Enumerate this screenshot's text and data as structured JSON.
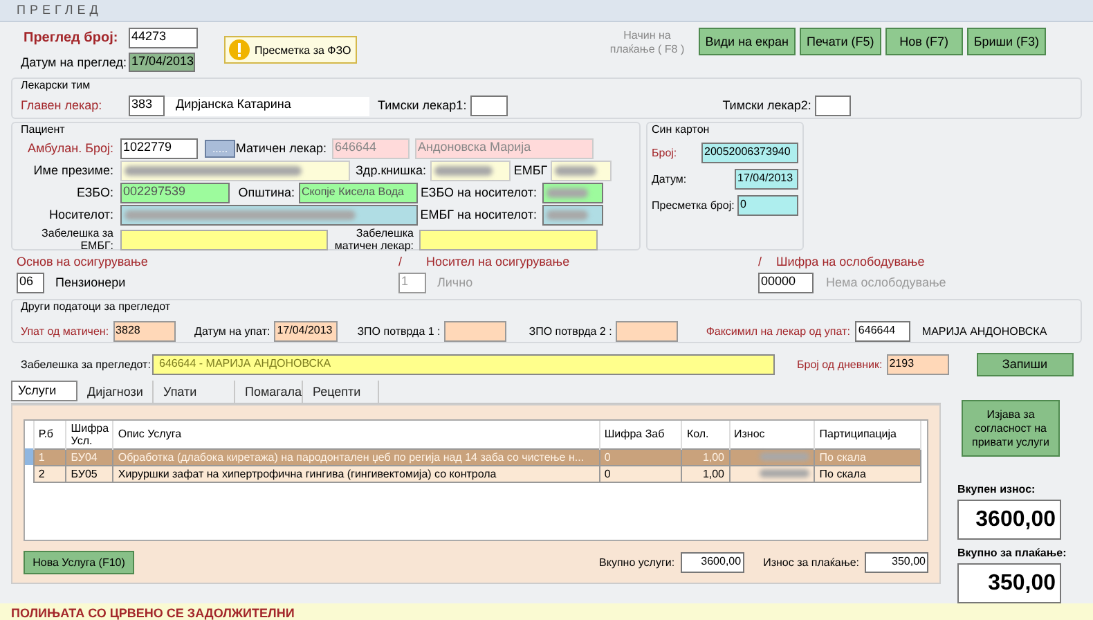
{
  "window": {
    "title": "ПРЕГЛЕД"
  },
  "exam": {
    "number_label": "Преглед број:",
    "number": "44273",
    "date_label": "Датум на преглед:",
    "date": "17/04/2013"
  },
  "fzo_button": "Пресметка за ФЗО",
  "payment_method": "Начин на плаќање ( F8 )",
  "toolbar_buttons": [
    "Види на екран",
    "Печати (F5)",
    "Нов (F7)",
    "Бриши (F3)"
  ],
  "medical_team": {
    "title": "Лекарски тим",
    "chief": {
      "label": "Главен лекар:",
      "required": true,
      "code": "383",
      "name": "Дирјанска Катарина"
    },
    "team1_label": "Тимски лекар1:",
    "team2_label": "Тимски лекар2:"
  },
  "patient": {
    "title": "Пациент",
    "ambulance": {
      "label": "Амбулан. Број:",
      "required": true,
      "value": "1022779"
    },
    "lookup_button": ".....",
    "family_doctor": {
      "label": "Матичен лекар:",
      "required": false,
      "code": "646644",
      "name": "Андоновска Марија"
    },
    "full_name": {
      "label": "Име презиме:",
      "required": false,
      "blurred": true
    },
    "health_card": {
      "label": "Здр.книшка:",
      "required": false,
      "blurred": true
    },
    "embg": {
      "label": "ЕМБГ",
      "required": false,
      "blurred": true
    },
    "ezbo": {
      "label": "ЕЗБО:",
      "required": false,
      "value": "002297539"
    },
    "municipality": {
      "label": "Општина:",
      "required": false,
      "value": "Скопје Кисела Вода"
    },
    "holder_ezbo": {
      "label": "ЕЗБО на носителот:",
      "required": false,
      "blurred": true
    },
    "holder": {
      "label": "Носителот:",
      "required": false,
      "blurred": true
    },
    "holder_embg": {
      "label": "ЕМБГ на носителот:",
      "required": false,
      "blurred": true
    },
    "embg_note": {
      "label": "Забелешка за ЕМБГ:",
      "required": false
    },
    "doctor_note": {
      "label": "Забелешка матичен лекар:",
      "required": false
    }
  },
  "blue_card": {
    "title": "Син картон",
    "number": {
      "label": "Број:",
      "required": true,
      "value": "20052006373940"
    },
    "date": {
      "label": "Датум:",
      "required": false,
      "value": "17/04/2013"
    },
    "calc": {
      "label": "Пресметка број:",
      "required": false,
      "value": "0"
    }
  },
  "insurance": {
    "basis": {
      "label": "Основ на осигурување",
      "code": "06",
      "text": "Пензионери",
      "disabled": false
    },
    "separator_1": "/",
    "holder": {
      "label": "Носител на осигурување",
      "code": "1",
      "text": "Лично",
      "disabled": true
    },
    "separator_2": "/",
    "exemption": {
      "label": "Шифра на ослободување",
      "code": "00000",
      "text": "Нема ослободување",
      "disabled": true
    }
  },
  "referral": {
    "title": "Други податоци за прегледот",
    "from_family": {
      "label": "Упат од матичен:",
      "required": true,
      "value": "3828"
    },
    "date": {
      "label": "Датум на упат:",
      "required": false,
      "value": "17/04/2013"
    },
    "zpo1": {
      "label": "ЗПО потврда 1 :",
      "required": false
    },
    "zpo2": {
      "label": "ЗПО потврда 2 :",
      "required": false
    },
    "facsimile": {
      "label": "Факсимил на лекар од упат:",
      "required": true,
      "value": "646644",
      "name": "МАРИЈА АНДОНОВСКА"
    }
  },
  "exam_note": {
    "label": "Забелешка за прегледот:",
    "required": false,
    "value": "646644 - МАРИЈА АНДОНОВСКА"
  },
  "journal": {
    "label": "Број од дневник:",
    "required": true,
    "value": "2193"
  },
  "save_button": "Запиши",
  "tabs": [
    {
      "label": "Услуги",
      "selected": true
    },
    {
      "label": "Дијагнози",
      "selected": false
    },
    {
      "label": "Упати",
      "selected": false
    },
    {
      "label": "Помагала",
      "selected": false
    },
    {
      "label": "Рецепти",
      "selected": false
    }
  ],
  "services": {
    "columns": [
      "Р.б",
      "Шифра Усл.",
      "Опис Услуга",
      "Шифра Заб",
      "Кол.",
      "Износ",
      "Партиципација"
    ],
    "rows": [
      {
        "selected": true,
        "number": "1",
        "code": "БУ04",
        "description": "Обработка (длабока киретажа) на пародонтален џеб по регија над 14 заба со чистење н...",
        "tooth_code": "0",
        "quantity": "1,00",
        "amount_blurred": true,
        "participation": "По скала"
      },
      {
        "selected": false,
        "number": "2",
        "code": "БУ05",
        "description": "Хируршки зафат на хипертрофична гингива (гингивектомија) со контрола",
        "tooth_code": "0",
        "quantity": "1,00",
        "amount_blurred": true,
        "participation": "По скала"
      }
    ]
  },
  "new_service_button": "Нова Услуга (F10)",
  "total_services": {
    "label": "Вкупно услуги:",
    "value": "3600,00"
  },
  "amount_to_pay": {
    "label": "Износ за плаќање:",
    "value": "350,00"
  },
  "consent_button": "Изјава за согласност на привати услуги",
  "totals": {
    "total_label": "Вкупен износ:",
    "total": "3600,00",
    "pay_label": "Вкупно за плаќање:",
    "pay": "350,00"
  },
  "footer": "ПОЛИЊАТА СО ЦРВЕНО СЕ ЗАДОЛЖИТЕЛНИ"
}
